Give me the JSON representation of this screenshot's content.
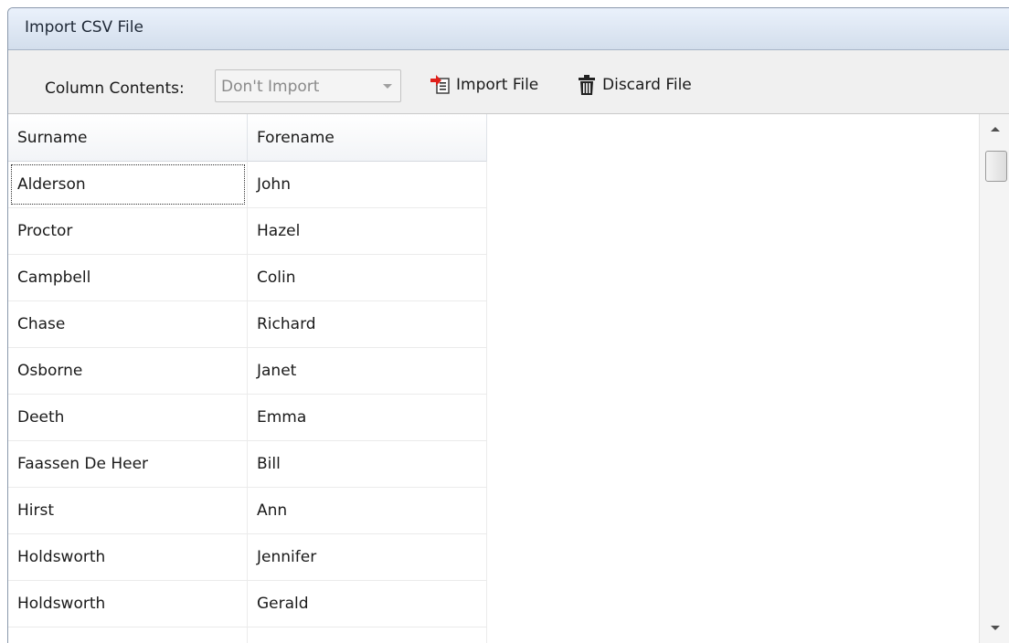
{
  "window": {
    "title": "Import CSV File"
  },
  "toolbar": {
    "column_contents_label": "Column Contents:",
    "column_contents_value": "Don't Import",
    "import_label": "Import File",
    "discard_label": "Discard File",
    "import_icon": "import-file-icon",
    "discard_icon": "trash-can-icon"
  },
  "grid": {
    "columns": [
      "Surname",
      "Forename"
    ],
    "rows": [
      [
        "Alderson",
        "John"
      ],
      [
        "Proctor",
        "Hazel"
      ],
      [
        "Campbell",
        "Colin"
      ],
      [
        "Chase",
        "Richard"
      ],
      [
        "Osborne",
        "Janet"
      ],
      [
        "Deeth",
        "Emma"
      ],
      [
        "Faassen De Heer",
        "Bill"
      ],
      [
        "Hirst",
        "Ann"
      ],
      [
        "Holdsworth",
        "Jennifer"
      ],
      [
        "Holdsworth",
        "Gerald"
      ],
      [
        "",
        ""
      ]
    ],
    "focused_row": 0,
    "focused_col": 0
  },
  "colors": {
    "title_bar_top": "#eaf1fb",
    "title_bar_bottom": "#d3deec",
    "toolbar_bg": "#f0f0f0",
    "import_arrow": "#e0201a"
  }
}
